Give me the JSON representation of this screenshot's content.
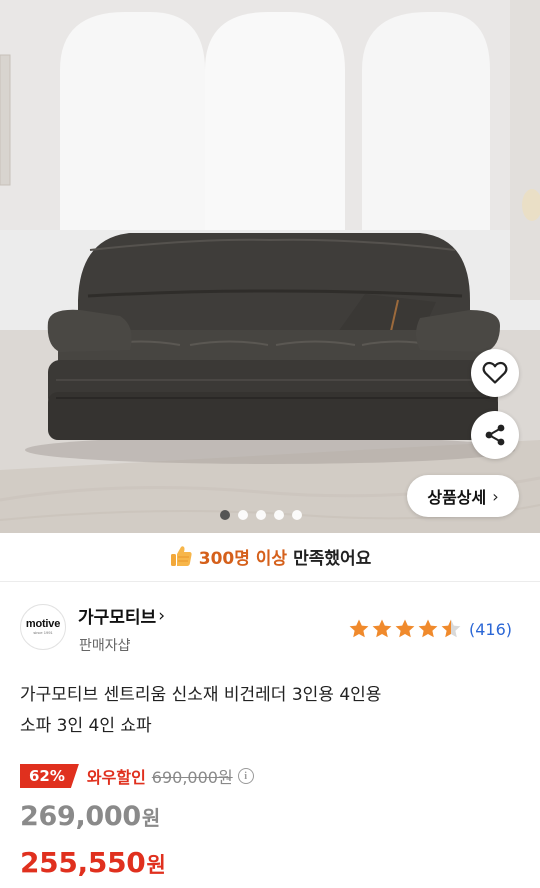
{
  "gallery": {
    "detail_button_label": "상품상세",
    "page_count": 5,
    "active_index": 0
  },
  "satisfaction": {
    "highlight": "300명 이상",
    "rest": "만족했어요"
  },
  "seller": {
    "logo_text": "motive",
    "logo_subtext": "since 1991",
    "name": "가구모티브",
    "type": "판매자샵"
  },
  "rating": {
    "stars": 4.5,
    "review_count": "(416)"
  },
  "product": {
    "title_line1": "가구모티브 센트리움 신소재 비건레더 3인용 4인용",
    "title_line2": "소파 3인 4인 쇼파"
  },
  "price": {
    "discount_badge": "62%",
    "promo_label": "와우할인",
    "original": "690,000원",
    "sale_value": "269,000",
    "sale_unit": "원",
    "final_value": "255,550",
    "final_unit": "원"
  },
  "colors": {
    "accent_red": "#e0301e",
    "accent_orange": "#d5601b",
    "star": "#f08a2c",
    "link_blue": "#2b67d6"
  }
}
